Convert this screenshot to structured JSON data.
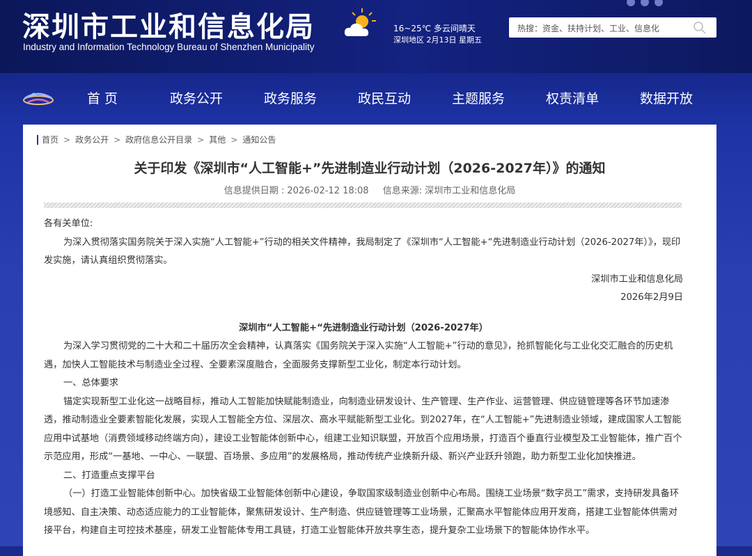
{
  "header": {
    "title": "深圳市工业和信息化局",
    "subtitle": "Industry and Information Technology Bureau of Shenzhen Municipality",
    "weather": {
      "temp_desc": "16~25℃   多云间晴天",
      "location_date": "深圳地区 2月13日   星期五"
    },
    "search": {
      "placeholder": "热搜：资金、扶持计划、工业、信息化"
    }
  },
  "nav": {
    "items": [
      {
        "label": "首 页"
      },
      {
        "label": "政务公开"
      },
      {
        "label": "政务服务"
      },
      {
        "label": "政民互动"
      },
      {
        "label": "主题服务"
      },
      {
        "label": "权责清单"
      },
      {
        "label": "数据开放"
      }
    ]
  },
  "breadcrumb": [
    "首页",
    "政务公开",
    "政府信息公开目录",
    "其他",
    "通知公告"
  ],
  "article": {
    "title": "关于印发《深圳市“人工智能+”先进制造业行动计划（2026-2027年）》的通知",
    "date_label": "信息提供日期 : 2026-02-12 18:08",
    "source_label": "信息来源:   深圳市工业和信息化局",
    "salutation": "各有关单位:",
    "intro": "为深入贯彻落实国务院关于深入实施“人工智能+”行动的相关文件精神，我局制定了《深圳市“人工智能+“先进制造业行动计划（2026-2027年）》，现印发实施，请认真组织贯彻落实。",
    "signature": "深圳市工业和信息化局",
    "sign_date": "2026年2月9日",
    "plan_title": "深圳市“人工智能+“先进制造业行动计划（2026-2027年）",
    "para1": "为深入学习贯彻党的二十大和二十届历次全会精神，认真落实《国务院关于深入实施“人工智能+”行动的意见》，抢抓智能化与工业化交汇融合的历史机遇，加快人工智能技术与制造业全过程、全要素深度融合，全面服务支撑新型工业化，制定本行动计划。",
    "section1": "一、总体要求",
    "para2": "锚定实现新型工业化这一战略目标，推动人工智能加快赋能制造业，向制造业研发设计、生产管理、生产作业、运营管理、供应链管理等各环节加速渗透，推动制造业全要素智能化发展，实现人工智能全方位、深层次、高水平赋能新型工业化。到2027年，在“人工智能+”先进制造业领域，建成国家人工智能应用中试基地（消费领域移动终端方向），建设工业智能体创新中心，组建工业知识联盟，开放百个应用场景，打造百个垂直行业模型及工业智能体，推广百个示范应用，形成“一基地、一中心、一联盟、百场景、多应用”的发展格局，推动传统产业焕新升级、新兴产业跃升领跑，助力新型工业化加快推进。",
    "section2": "二、打造重点支撑平台",
    "para3": "（一）打造工业智能体创新中心。加快省级工业智能体创新中心建设，争取国家级制造业创新中心布局。围绕工业场景“数字员工”需求，支持研发具备环境感知、自主决策、动态适应能力的工业智能体，聚焦研发设计、生产制造、供应链管理等工业场景，汇聚高水平智能体应用开发商，搭建工业智能体供需对接平台，构建自主可控技术基座，研发工业智能体专用工具链，打造工业智能体开放共享生态，提升复杂工业场景下的智能体协作水平。"
  }
}
